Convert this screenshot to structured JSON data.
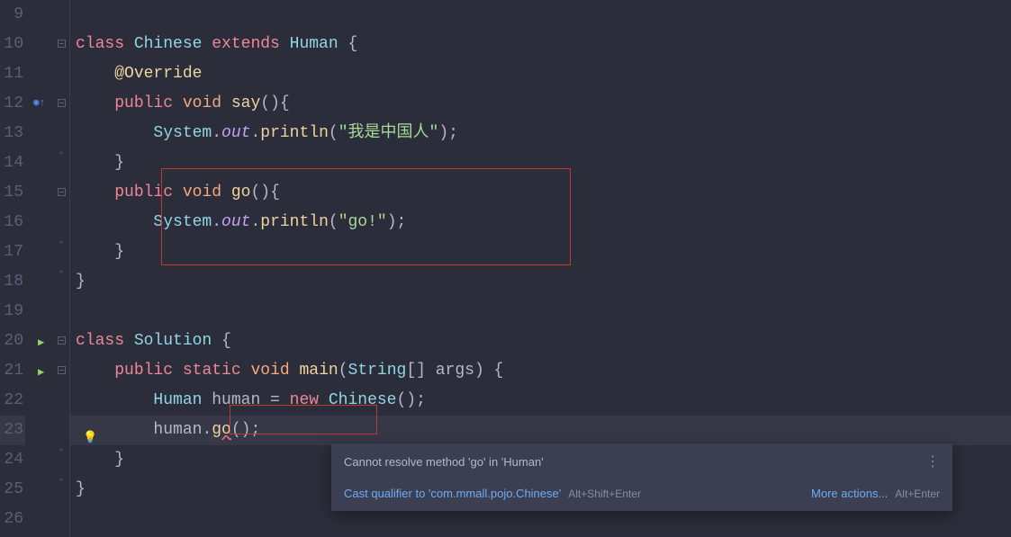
{
  "lines": {
    "9": "9",
    "10": "10",
    "11": "11",
    "12": "12",
    "13": "13",
    "14": "14",
    "15": "15",
    "16": "16",
    "17": "17",
    "18": "18",
    "19": "19",
    "20": "20",
    "21": "21",
    "22": "22",
    "23": "23",
    "24": "24",
    "25": "25",
    "26": "26"
  },
  "code": {
    "l10_class": "class ",
    "l10_chinese": "Chinese ",
    "l10_extends": "extends ",
    "l10_human": "Human ",
    "l10_b": "{",
    "l11_ann": "@Override",
    "l12_public": "public ",
    "l12_void": "void ",
    "l12_say": "say",
    "l12_p": "(){",
    "l13_sys": "System",
    "l13_d1": ".",
    "l13_out": "out",
    "l13_d2": ".",
    "l13_println": "println",
    "l13_o": "(",
    "l13_str": "\"我是中国人\"",
    "l13_c": ");",
    "l14_b": "}",
    "l15_public": "public ",
    "l15_void": "void ",
    "l15_go": "go",
    "l15_p": "(){",
    "l16_sys": "System",
    "l16_d1": ".",
    "l16_out": "out",
    "l16_d2": ".",
    "l16_println": "println",
    "l16_o": "(",
    "l16_str": "\"go!\"",
    "l16_c": ");",
    "l17_b": "}",
    "l18_b": "}",
    "l20_class": "class ",
    "l20_solution": "Solution ",
    "l20_b": "{",
    "l21_public": "public ",
    "l21_static": "static ",
    "l21_void": "void ",
    "l21_main": "main",
    "l21_o": "(",
    "l21_string": "String",
    "l21_arr": "[] ",
    "l21_args": "args",
    "l21_c": ") {",
    "l22_human1": "Human ",
    "l22_human2": "human ",
    "l22_eq": "= ",
    "l22_new": "new ",
    "l22_chinese": "Chinese",
    "l22_c": "();",
    "l23_human": "human",
    "l23_d": ".",
    "l23_go": "go",
    "l23_c": "();",
    "l24_b": "}",
    "l25_b": "}"
  },
  "hint": {
    "message": "Cannot resolve method 'go' in 'Human'",
    "fix": "Cast qualifier to 'com.mmall.pojo.Chinese'",
    "sc1": "Alt+Shift+Enter",
    "more": "More actions...",
    "sc2": "Alt+Enter"
  }
}
